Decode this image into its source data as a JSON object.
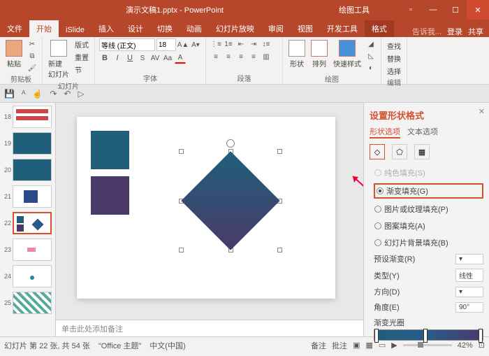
{
  "title": {
    "filename": "演示文稿1.pptx - PowerPoint",
    "context_tool": "绘图工具"
  },
  "tabs": {
    "file": "文件",
    "home": "开始",
    "islide": "iSlide",
    "insert": "插入",
    "design": "设计",
    "transition": "切换",
    "animation": "动画",
    "slideshow": "幻灯片放映",
    "review": "审阅",
    "view": "视图",
    "developer": "开发工具",
    "format": "格式",
    "tell_me": "告诉我...",
    "signin": "登录",
    "share": "共享"
  },
  "ribbon": {
    "clipboard": {
      "paste": "粘贴",
      "label": "剪贴板"
    },
    "slides": {
      "new": "新建\n幻灯片",
      "layout": "版式",
      "reset": "重置",
      "section": "节",
      "label": "幻灯片"
    },
    "font": {
      "family": "等线 (正文)",
      "size": "18",
      "label": "字体"
    },
    "paragraph": {
      "label": "段落"
    },
    "drawing": {
      "shapes": "形状",
      "arrange": "排列",
      "quickstyle": "快速样式",
      "label": "绘图"
    },
    "editing": {
      "find": "查找",
      "replace": "替换",
      "select": "选择",
      "label": "编辑"
    }
  },
  "thumbs": [
    {
      "n": "18"
    },
    {
      "n": "19"
    },
    {
      "n": "20"
    },
    {
      "n": "21"
    },
    {
      "n": "22"
    },
    {
      "n": "23"
    },
    {
      "n": "24"
    },
    {
      "n": "25"
    }
  ],
  "notes_placeholder": "单击此处添加备注",
  "pane": {
    "title": "设置形状格式",
    "tab_shape": "形状选项",
    "tab_text": "文本选项",
    "fill_solid": "纯色填充(S)",
    "fill_gradient": "渐变填充(G)",
    "fill_picture": "图片或纹理填充(P)",
    "fill_pattern": "图案填充(A)",
    "fill_slidebg": "幻灯片背景填充(B)",
    "preset": "预设渐变(R)",
    "type": "类型(Y)",
    "type_val": "线性",
    "direction": "方向(D)",
    "angle": "角度(E)",
    "angle_val": "90°",
    "stops": "渐变光圈"
  },
  "status": {
    "slide": "幻灯片 第 22 张, 共 54 张",
    "theme": "\"Office 主题\"",
    "lang": "中文(中国)",
    "notes": "备注",
    "comments": "批注",
    "zoom": "42%"
  }
}
